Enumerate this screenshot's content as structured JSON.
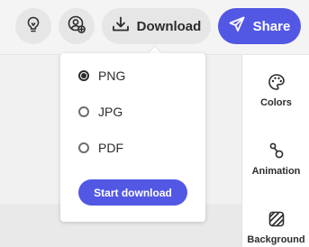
{
  "toolbar": {
    "ideas_icon": "lightbulb-icon",
    "invite_icon": "add-user-icon",
    "download_icon": "download-icon",
    "download_label": "Download",
    "share_icon": "paper-plane-icon",
    "share_label": "Share"
  },
  "download_menu": {
    "options": [
      {
        "label": "PNG",
        "selected": true
      },
      {
        "label": "JPG",
        "selected": false
      },
      {
        "label": "PDF",
        "selected": false
      }
    ],
    "start_label": "Start download"
  },
  "right_panel": {
    "items": [
      {
        "label": "Colors",
        "icon": "palette-icon"
      },
      {
        "label": "Animation",
        "icon": "animation-icon"
      },
      {
        "label": "Background",
        "icon": "background-icon"
      }
    ]
  },
  "colors": {
    "accent": "#5258e4",
    "button_gray": "#e6e6e6",
    "text": "#2c2c2c"
  }
}
